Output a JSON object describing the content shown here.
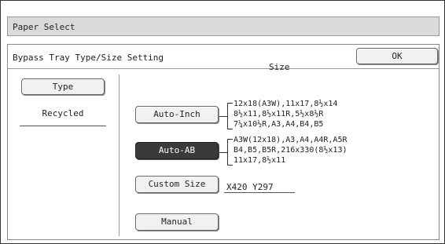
{
  "window": {
    "title": "Paper Select"
  },
  "header": {
    "title": "Bypass Tray Type/Size Setting",
    "ok_label": "OK"
  },
  "type_section": {
    "button_label": "Type",
    "value": "Recycled"
  },
  "size_section": {
    "label": "Size",
    "auto_inch": {
      "label": "Auto-Inch",
      "sizes": [
        "12x18(A3W),11x17,8½x14",
        "8½x11,8½x11R,5½x8½R",
        "7¼x10½R,A3,A4,B4,B5"
      ]
    },
    "auto_ab": {
      "label": "Auto-AB",
      "selected": true,
      "sizes": [
        "A3W(12x18),A3,A4,A4R,A5R",
        "B4,B5,B5R,216x330(8½x13)",
        "11x17,8½x11"
      ]
    },
    "custom": {
      "label": "Custom Size",
      "value": "X420 Y297"
    },
    "manual": {
      "label": "Manual"
    }
  }
}
